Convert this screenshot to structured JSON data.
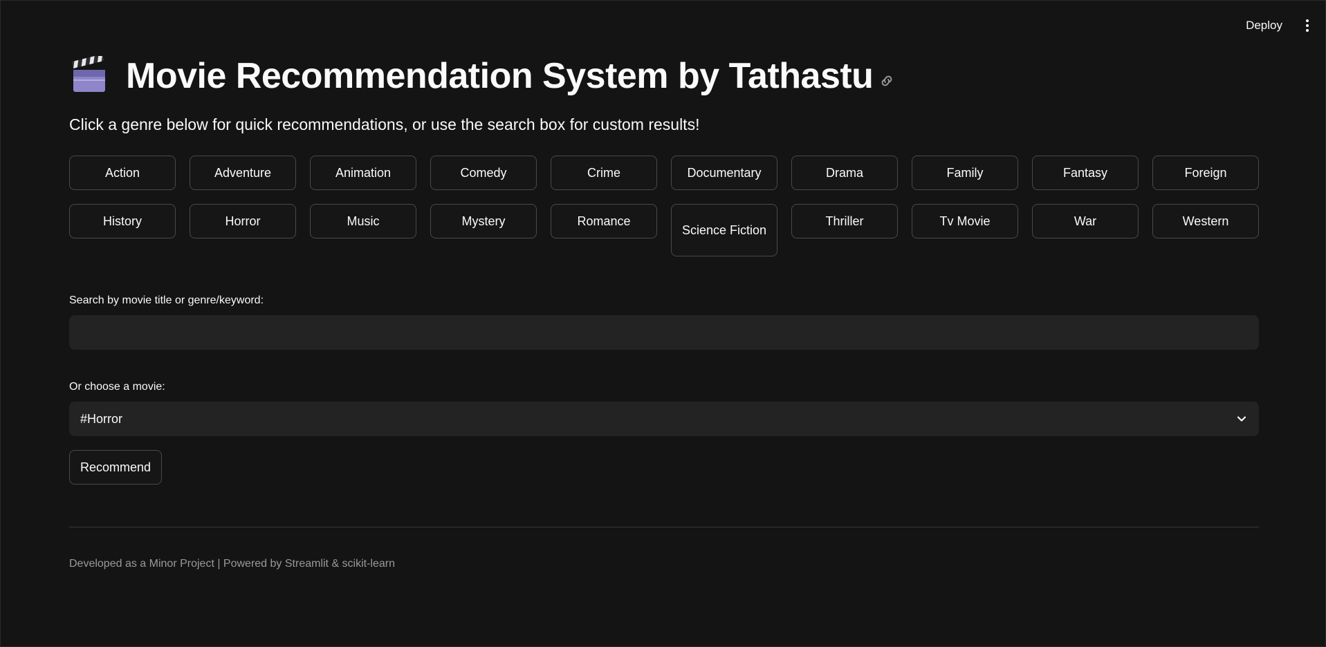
{
  "toolbar": {
    "deploy_label": "Deploy"
  },
  "header": {
    "title": "Movie Recommendation System by Tathastu",
    "subtitle": "Click a genre below for quick recommendations, or use the search box for custom results!"
  },
  "genres": {
    "action": "Action",
    "adventure": "Adventure",
    "animation": "Animation",
    "comedy": "Comedy",
    "crime": "Crime",
    "documentary": "Documentary",
    "drama": "Drama",
    "family": "Family",
    "fantasy": "Fantasy",
    "foreign": "Foreign",
    "history": "History",
    "horror": "Horror",
    "music": "Music",
    "mystery": "Mystery",
    "romance": "Romance",
    "science_fiction": "Science Fiction",
    "thriller": "Thriller",
    "tv_movie": "Tv Movie",
    "war": "War",
    "western": "Western"
  },
  "search": {
    "label": "Search by movie title or genre/keyword:",
    "value": "",
    "placeholder": ""
  },
  "movie_select": {
    "label": "Or choose a movie:",
    "selected": "#Horror"
  },
  "recommend_label": "Recommend",
  "footer": "Developed as a Minor Project | Powered by Streamlit & scikit-learn",
  "icons": {
    "title_icon": "clapper-board-icon",
    "anchor_icon": "link-icon",
    "menu_icon": "vertical-dots-icon",
    "select_icon": "chevron-down-icon"
  },
  "colors": {
    "background": "#141414",
    "text": "#fafafa",
    "button_border": "#4a4a4f",
    "input_background": "#232323",
    "muted_text": "#9a9a9a"
  }
}
